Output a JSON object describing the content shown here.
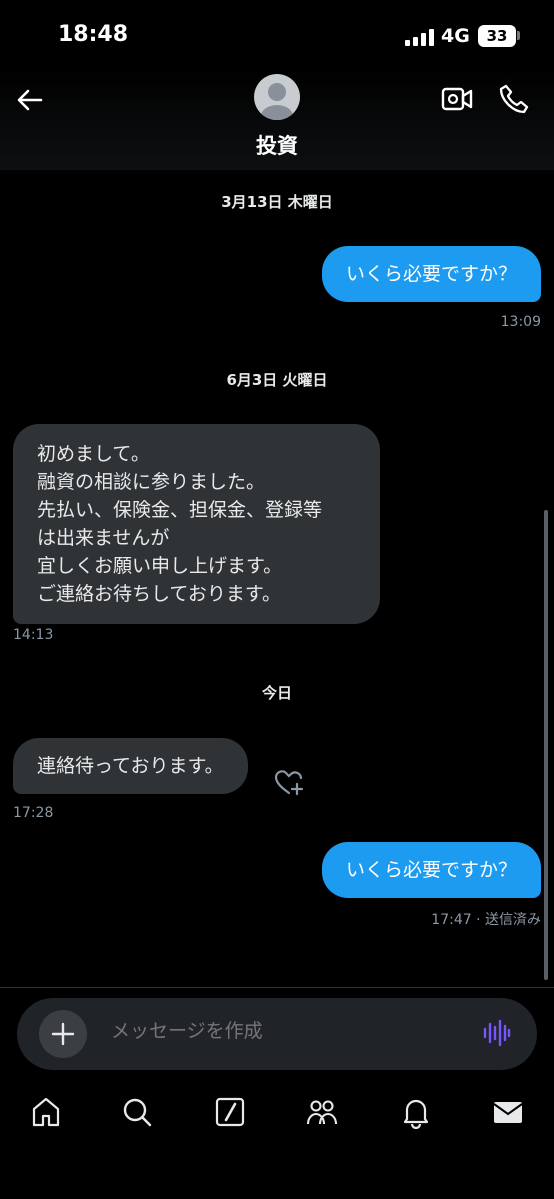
{
  "status_bar": {
    "time": "18:48",
    "network": "4G",
    "battery": "33"
  },
  "header": {
    "title": "投資",
    "icons": [
      "back-arrow-icon",
      "avatar",
      "video-call-icon",
      "phone-icon"
    ]
  },
  "messages": [
    {
      "type": "date",
      "text": "3月13日 木曜日"
    },
    {
      "type": "outgoing",
      "text": "いくら必要ですか？",
      "time": "13:09"
    },
    {
      "type": "date",
      "text": "6月3日 火曜日"
    },
    {
      "type": "incoming",
      "lines": [
        "初めまして。",
        "融資の相談に参りました。",
        "先払い、保険金、担保金、登録等",
        "は出来ませんが",
        "宜しくお願い申し上げます。",
        "ご連絡お待ちしております。"
      ],
      "time": "14:13"
    },
    {
      "type": "date",
      "text": "今日"
    },
    {
      "type": "incoming",
      "text": "連絡待っております。",
      "time": "17:28"
    },
    {
      "type": "outgoing",
      "text": "いくら必要ですか？",
      "time": "17:47 · 送信済み"
    }
  ],
  "compose": {
    "placeholder": "メッセージを作成"
  },
  "tabbar": {
    "items": [
      "home-icon",
      "search-icon",
      "grok-icon",
      "communities-icon",
      "notifications-icon",
      "messages-icon"
    ]
  },
  "colors": {
    "accent": "#1d9bf0",
    "incoming_bubble": "#2f3336",
    "voice": "#7856ff"
  }
}
